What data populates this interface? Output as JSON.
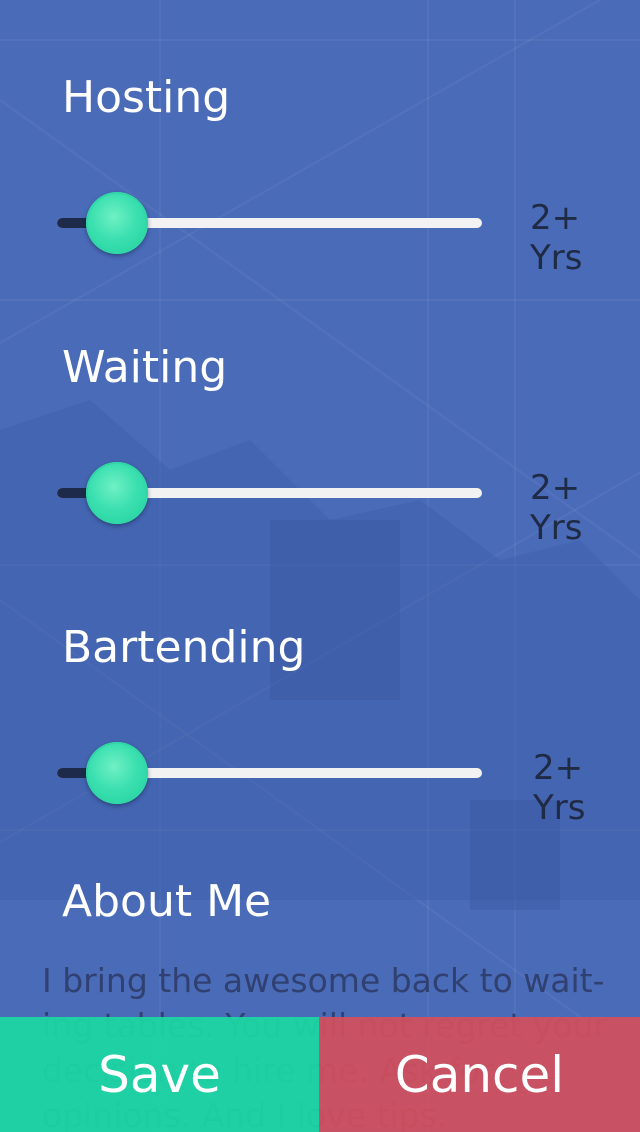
{
  "sections": [
    {
      "title": "Hosting",
      "value_label": "2+ Yrs",
      "slider_fraction": 0.14
    },
    {
      "title": "Waiting",
      "value_label": "2+ Yrs",
      "slider_fraction": 0.14
    },
    {
      "title": "Bartending",
      "value_label": "2+ Yrs",
      "slider_fraction": 0.14
    }
  ],
  "about": {
    "title": "About Me",
    "text": "I bring the awesome back to wait-ing tables. You will not regret your decision to hire me. Ask for opinions. And I love tips."
  },
  "actions": {
    "save_label": "Save",
    "cancel_label": "Cancel"
  },
  "colors": {
    "background": "#4a6bb8",
    "accent_green": "#1fd6a4",
    "accent_red": "#d2505c",
    "track_filled": "#1e2a4a",
    "track_empty": "#f2f2f2"
  }
}
